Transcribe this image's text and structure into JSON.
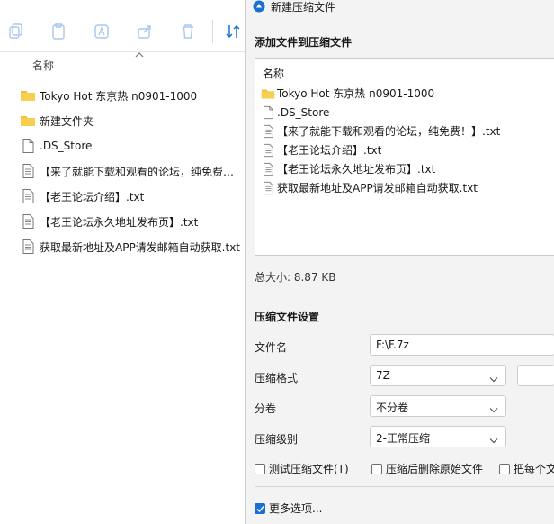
{
  "explorer": {
    "column_name": "名称",
    "files": [
      {
        "name": "Tokyo Hot 东京热 n0901-1000",
        "icon": "folder-icon"
      },
      {
        "name": "新建文件夹",
        "icon": "folder-icon"
      },
      {
        "name": ".DS_Store",
        "icon": "file-icon"
      },
      {
        "name": "【来了就能下载和观看的论坛，纯免费！】.txt",
        "icon": "text-file-icon"
      },
      {
        "name": "【老王论坛介绍】.txt",
        "icon": "text-file-icon"
      },
      {
        "name": "【老王论坛永久地址发布页】.txt",
        "icon": "text-file-icon"
      },
      {
        "name": "获取最新地址及APP请发邮箱自动获取.txt",
        "icon": "text-file-icon"
      }
    ]
  },
  "dialog": {
    "title": "新建压缩文件",
    "add_files_heading": "添加文件到压缩文件",
    "box_header": "名称",
    "box_files": [
      {
        "name": "Tokyo Hot 东京热 n0901-1000",
        "icon": "folder-icon"
      },
      {
        "name": ".DS_Store",
        "icon": "file-icon"
      },
      {
        "name": "【来了就能下载和观看的论坛，纯免费！】.txt",
        "icon": "text-file-icon"
      },
      {
        "name": "【老王论坛介绍】.txt",
        "icon": "text-file-icon"
      },
      {
        "name": "【老王论坛永久地址发布页】.txt",
        "icon": "text-file-icon"
      },
      {
        "name": "获取最新地址及APP请发邮箱自动获取.txt",
        "icon": "text-file-icon"
      }
    ],
    "total_size": "总大小: 8.87 KB",
    "settings_heading": "压缩文件设置",
    "filename_label": "文件名",
    "filename_value": "F:\\F.7z",
    "format_label": "压缩格式",
    "format_value": "7Z",
    "split_label": "分卷",
    "split_value": "不分卷",
    "level_label": "压缩级别",
    "level_value": "2-正常压缩",
    "test_label": "测试压缩文件(T)",
    "delete_label": "压缩后删除原始文件",
    "each_label": "把每个文",
    "more_options_label": "更多选项...",
    "accent_color": "#1a6fd4",
    "folder_color": "#f0c03c"
  }
}
